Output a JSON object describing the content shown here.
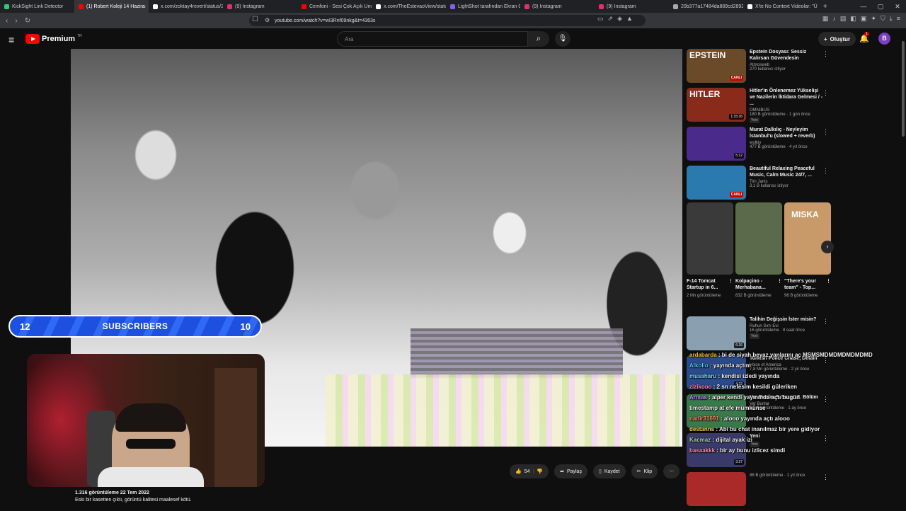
{
  "browser": {
    "tabs": [
      {
        "label": "KickSight Link Detector",
        "color": "#2ecc71",
        "active": false
      },
      {
        "label": "(1) Robert Koleji 14 Hazira",
        "color": "#ff0000",
        "active": true
      },
      {
        "label": "x.com/zoktay4revert/status/2",
        "color": "#ffffff",
        "active": false
      },
      {
        "label": "(9) Instagram",
        "color": "#e1306c",
        "active": false
      },
      {
        "label": "Cemfoni - Sesi Çok Açık Unut",
        "color": "#ff0000",
        "active": false
      },
      {
        "label": "x.com/TheEstevaoView/status/",
        "color": "#ffffff",
        "active": false
      },
      {
        "label": "LightShot tarafından Ekran Gö",
        "color": "#8a5cf6",
        "active": false
      },
      {
        "label": "(9) Instagram",
        "color": "#e1306c",
        "active": false
      },
      {
        "label": "(9) Instagram",
        "color": "#e1306c",
        "active": false
      },
      {
        "label": "20b377a17484da889cd2892",
        "color": "#aaaaaa",
        "active": false
      },
      {
        "label": "X'te No Context Videolar: \"Ünl",
        "color": "#ffffff",
        "active": false
      }
    ],
    "url": "youtube.com/watch?v=wI3Rnf09nkg&t=4363s"
  },
  "youtube": {
    "logo_text": "Premium",
    "logo_region": "TR",
    "search_placeholder": "Ara",
    "create_label": "Oluştur",
    "notif_count": "1",
    "avatar_letter": "B"
  },
  "overlay": {
    "sub_left": "12",
    "sub_label": "SUBSCRIBERS",
    "sub_right": "10"
  },
  "actions": {
    "likes": "54",
    "share": "Paylaş",
    "save": "Kaydet",
    "clip": "Klip"
  },
  "description": {
    "meta": "1.316 görüntüleme  22 Tem 2022",
    "text": "Eski bir kasetten çıktı, görüntü kalitesi maalesef kötü."
  },
  "recommendations": [
    {
      "title": "Epstein Dosyası: Sessiz Kalırsan Güvendesin",
      "channel": "Atmosweb",
      "meta": "270 kullanıcı izliyor",
      "badge": "CANLI",
      "thumb_text": "EPSTEIN",
      "bg": "#6b4a2a"
    },
    {
      "title": "Hitler'in Önlenemez Yükselişi ve Nazilerin İktidara Gelmesi / - ...",
      "channel": "OMNIBUS",
      "meta": "180 B görüntüleme · 1 gün önce",
      "tag": "Yeni",
      "duration": "1:15:36",
      "thumb_text": "HITLER",
      "bg": "#8a2a1a"
    },
    {
      "title": "Murat Dalkılıç - Neyleyim İstanbul'u (slowed + reverb)",
      "channel": "wolkiy",
      "meta": "477 B görüntüleme · 4 yıl önce",
      "duration": "5:12",
      "bg": "#4a2a8a"
    },
    {
      "title": "Beautiful Relaxing Peaceful Music, Calm Music 24/7, ...",
      "channel": "Tim Janis",
      "meta": "3,1 B kullanıcı izliyor",
      "badge": "CANLI",
      "bg": "#2a7ab0"
    }
  ],
  "shorts": [
    {
      "title": "F-14 Tomcat Startup in 6...",
      "views": "2 Mn görüntüleme",
      "bg": "#3a3a3a"
    },
    {
      "title": "Kolpaçino - Merhabana...",
      "views": "832 B görüntüleme",
      "bg": "#5a6a4a"
    },
    {
      "title": "\"There's your team\" - Top...",
      "views": "96 B görüntüleme",
      "bg": "#c89a6a",
      "thumb_text": "MISKA"
    }
  ],
  "recommendations2": [
    {
      "title": "Talihin Değişsin İster misin?",
      "channel": "Ruhun Sırrı Evi",
      "meta": "16 görüntüleme · 8 saat önce",
      "tag": "Yeni",
      "duration": "6:26",
      "bg": "#8aa0b0"
    },
    {
      "title": "Turkish Police Chase, Detain",
      "channel": "Voice of America",
      "meta": "7,8 Mn görüntüleme · 2 yıl önce",
      "duration": "4:32",
      "bg": "#2a4a8a"
    },
    {
      "title": "Var Bunlar 3. Sezon 8. Bölüm",
      "channel": "Var Bunlar",
      "meta": "6,3 B görüntüleme · 1 ay önce",
      "bg": "#3a7a4a"
    },
    {
      "title": "Yeni",
      "channel": "",
      "meta": "",
      "tag": "Yeni",
      "duration": "3:27",
      "bg": "#3a3a6a"
    },
    {
      "title": "",
      "channel": "",
      "meta": "86 B görüntüleme · 1 yıl önce",
      "bg": "#aa2a2a"
    }
  ],
  "chat": [
    {
      "user": "ardabarda",
      "color": "#f7b733",
      "text": "bi de siyah beyaz yanlarını aç MSMSMDMDMDMDMDMD"
    },
    {
      "user": "Alkolio",
      "color": "#4fc3f7",
      "text": "yayında açtım"
    },
    {
      "user": "musaharu",
      "color": "#81d4fa",
      "text": "kendisi izledi yayında"
    },
    {
      "user": "zizikooo",
      "color": "#ff80ab",
      "text": "2 sn nefesim kesildi güleriken"
    },
    {
      "user": "Arnias",
      "color": "#b388ff",
      "text": "alper kendi yayınında açtı bugün"
    },
    {
      "user": "",
      "color": "#ffffff",
      "text": "timestamp at efe mümkünse"
    },
    {
      "user": "nadir31691",
      "color": "#ff8a65",
      "text": "alooo yayında açtı alooo"
    },
    {
      "user": "destanns",
      "color": "#ffd54f",
      "text": "Abi bu chat inanılmaz bir yere gidiyor"
    },
    {
      "user": "Kacmaz",
      "color": "#a5d6a7",
      "text": "dijital ayak izi"
    },
    {
      "user": "basaakkk",
      "color": "#f48fb1",
      "text": "bir ay bunu izlicez simdi"
    }
  ]
}
